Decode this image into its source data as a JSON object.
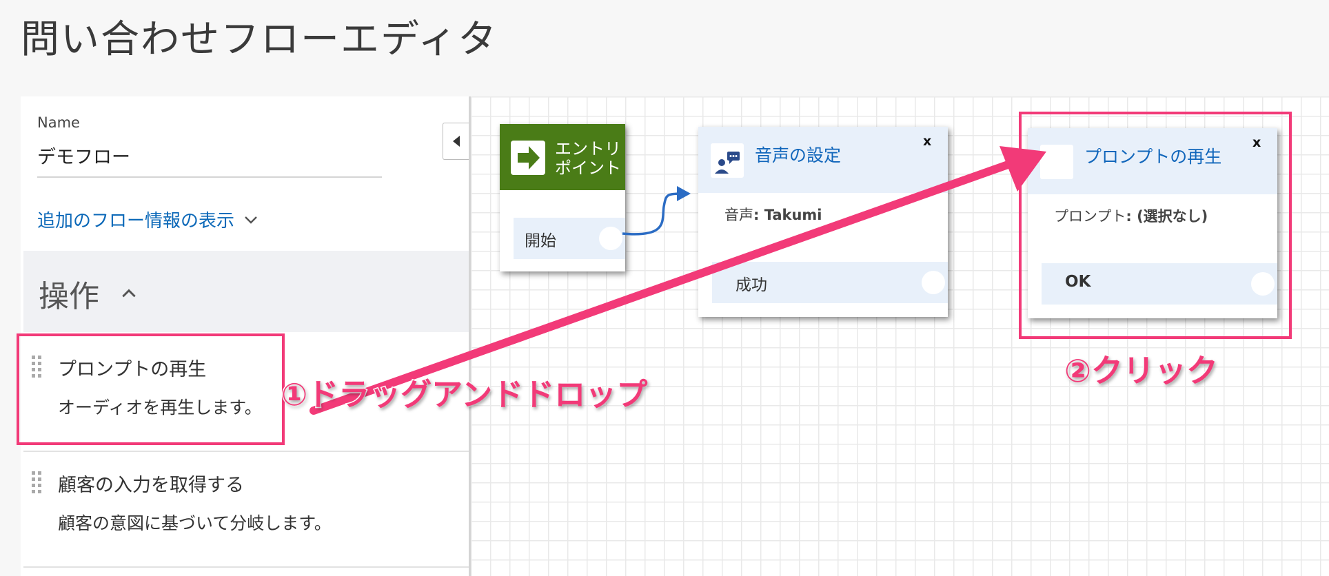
{
  "page_title": "問い合わせフローエディタ",
  "flow": {
    "name_label": "Name",
    "name_value": "デモフロー",
    "more_info_link": "追加のフロー情報の表示"
  },
  "operations": {
    "title": "操作",
    "items": [
      {
        "title": "プロンプトの再生",
        "description": "オーディオを再生します。"
      },
      {
        "title": "顧客の入力を取得する",
        "description": "顧客の意図に基づいて分岐します。"
      }
    ]
  },
  "canvas": {
    "entry_block": {
      "title": "エントリポイント",
      "branch": "開始"
    },
    "voice_block": {
      "title": "音声の設定",
      "close": "x",
      "param_label": "音声",
      "param_value": ": Takumi",
      "branch": "成功"
    },
    "prompt_block": {
      "title": "プロンプトの再生",
      "close": "x",
      "param_label": "プロンプト",
      "param_value": ": (選択なし)",
      "branch": "OK"
    }
  },
  "annotations": {
    "step1": "①ドラッグアンドドロップ",
    "step2": "②クリック"
  },
  "colors": {
    "accent_pink": "#f23a78",
    "link_blue": "#0b68b8",
    "entry_green": "#4a7c17",
    "block_header": "#e8f0fa"
  }
}
